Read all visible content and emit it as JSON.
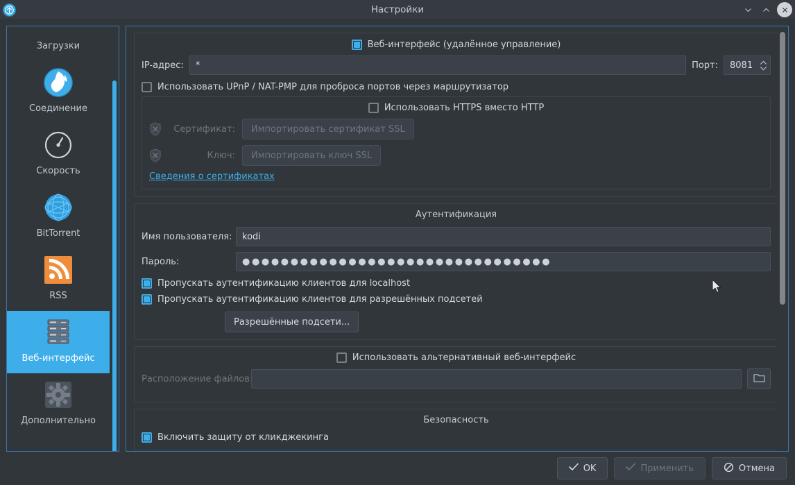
{
  "window": {
    "title": "Настройки",
    "app_icon": "qbittorrent-icon",
    "controls": {
      "minimize": "chevron-down-icon",
      "maximize": "chevron-up-icon",
      "close": "close-icon"
    }
  },
  "sidebar": {
    "items": [
      {
        "label": "Загрузки",
        "icon": "download-arrow-icon",
        "selected": false
      },
      {
        "label": "Соединение",
        "icon": "globe-icon",
        "selected": false
      },
      {
        "label": "Скорость",
        "icon": "speedometer-icon",
        "selected": false
      },
      {
        "label": "BitTorrent",
        "icon": "network-globe-icon",
        "selected": false
      },
      {
        "label": "RSS",
        "icon": "rss-icon",
        "selected": false
      },
      {
        "label": "Веб-интерфейс",
        "icon": "server-icon",
        "selected": true
      },
      {
        "label": "Дополнительно",
        "icon": "gear-icon",
        "selected": false
      }
    ]
  },
  "main": {
    "web_ui": {
      "enable_label": "Веб-интерфейс (удалённое управление)",
      "enable_checked": true,
      "ip_label": "IP-адрес:",
      "ip_value": "*",
      "port_label": "Порт:",
      "port_value": "8081",
      "upnp_label": "Использовать UPnP / NAT-PMP для проброса портов через маршрутизатор",
      "upnp_checked": false
    },
    "https": {
      "use_https_label": "Использовать HTTPS вместо HTTP",
      "use_https_checked": false,
      "certificate_label": "Сертификат:",
      "certificate_button": "Импортировать сертификат SSL",
      "key_label": "Ключ:",
      "key_button": "Импортировать ключ SSL",
      "info_link": "Сведения о сертификатах",
      "cert_icon": "shield-icon",
      "key_icon": "shield-icon"
    },
    "auth": {
      "title": "Аутентификация",
      "username_label": "Имя пользователя:",
      "username_value": "kodi",
      "password_label": "Пароль:",
      "password_value": "●●●●●●●●●●●●●●●●●●●●●●●●●●●●●●●●",
      "bypass_localhost_label": "Пропускать аутентификацию клиентов для localhost",
      "bypass_localhost_checked": true,
      "bypass_subnets_label": "Пропускать аутентификацию клиентов для разрешённых подсетей",
      "bypass_subnets_checked": true,
      "subnets_button": "Разрешённые подсети..."
    },
    "alt_ui": {
      "use_alt_label": "Использовать альтернативный веб-интерфейс",
      "use_alt_checked": false,
      "files_label": "Расположение файлов:",
      "files_value": "",
      "browse_icon": "folder-icon"
    },
    "security": {
      "title": "Безопасность",
      "clickjacking_label": "Включить защиту от кликджекинга",
      "clickjacking_checked": true
    }
  },
  "footer": {
    "ok_label": "OK",
    "ok_icon": "check-icon",
    "apply_label": "Применить",
    "apply_icon": "check-icon",
    "apply_enabled": false,
    "cancel_label": "Отмена",
    "cancel_icon": "cancel-icon"
  },
  "colors": {
    "accent": "#3daee9",
    "window_bg": "#31363b",
    "titlebar_bg": "#363b42",
    "field_bg": "#3b4149",
    "rss_orange": "#ef8d3c"
  }
}
